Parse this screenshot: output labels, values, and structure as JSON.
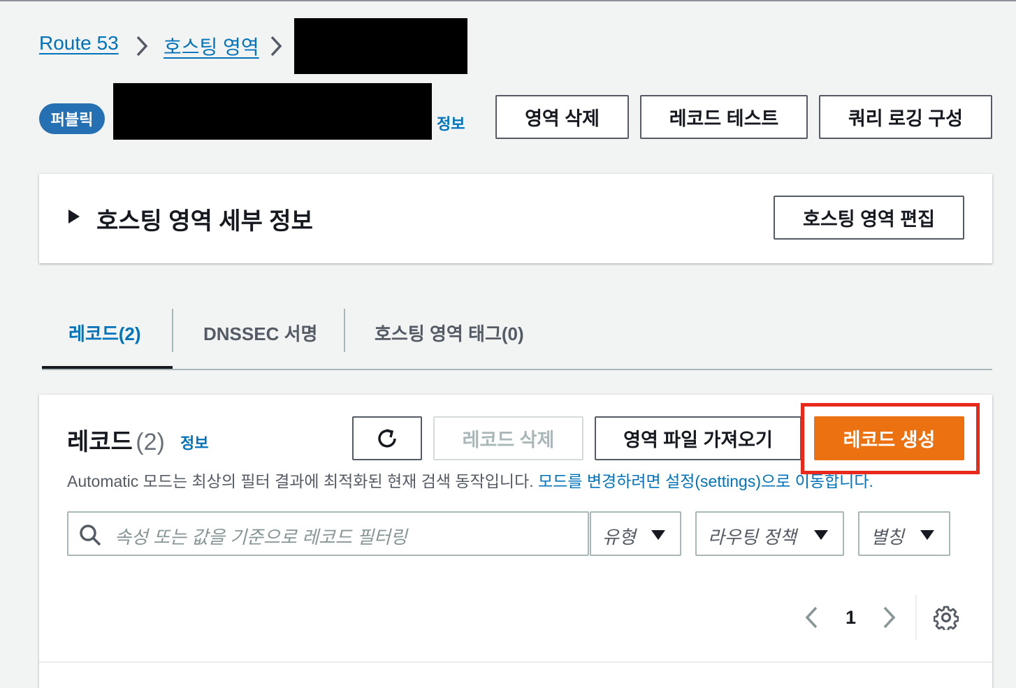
{
  "breadcrumb": {
    "items": [
      "Route 53",
      "호스팅 영역"
    ],
    "separator": ">"
  },
  "zone_header": {
    "badge": "퍼블릭",
    "info_link": "정보",
    "buttons": {
      "delete_zone": "영역 삭제",
      "test_record": "레코드 테스트",
      "query_logging": "쿼리 로깅 구성"
    }
  },
  "details_panel": {
    "title": "호스팅 영역 세부 정보",
    "edit_button": "호스팅 영역 편집"
  },
  "tabs": [
    {
      "label": "레코드(2)",
      "active": true
    },
    {
      "label": "DNSSEC 서명",
      "active": false
    },
    {
      "label": "호스팅 영역 태그(0)",
      "active": false
    }
  ],
  "records": {
    "title": "레코드",
    "count": "(2)",
    "info_link": "정보",
    "refresh_icon": "refresh-icon",
    "delete_button": "레코드 삭제",
    "import_button": "영역 파일 가져오기",
    "create_button": "레코드 생성",
    "description": "Automatic 모드는 최상의 필터 결과에 최적화된 현재 검색 동작입니다.",
    "description_link": "모드를 변경하려면 설정(settings)으로 이동합니다.",
    "search": {
      "placeholder": "속성 또는 값을 기준으로 레코드 필터링"
    },
    "filters": {
      "type": "유형",
      "routing_policy": "라우팅 정책",
      "alias": "별칭"
    },
    "pagination": {
      "current_page": "1"
    }
  },
  "colors": {
    "primary_button": "#ec7211",
    "link": "#0073bb",
    "highlight_box": "#e8291c",
    "badge": "#2470b3"
  }
}
